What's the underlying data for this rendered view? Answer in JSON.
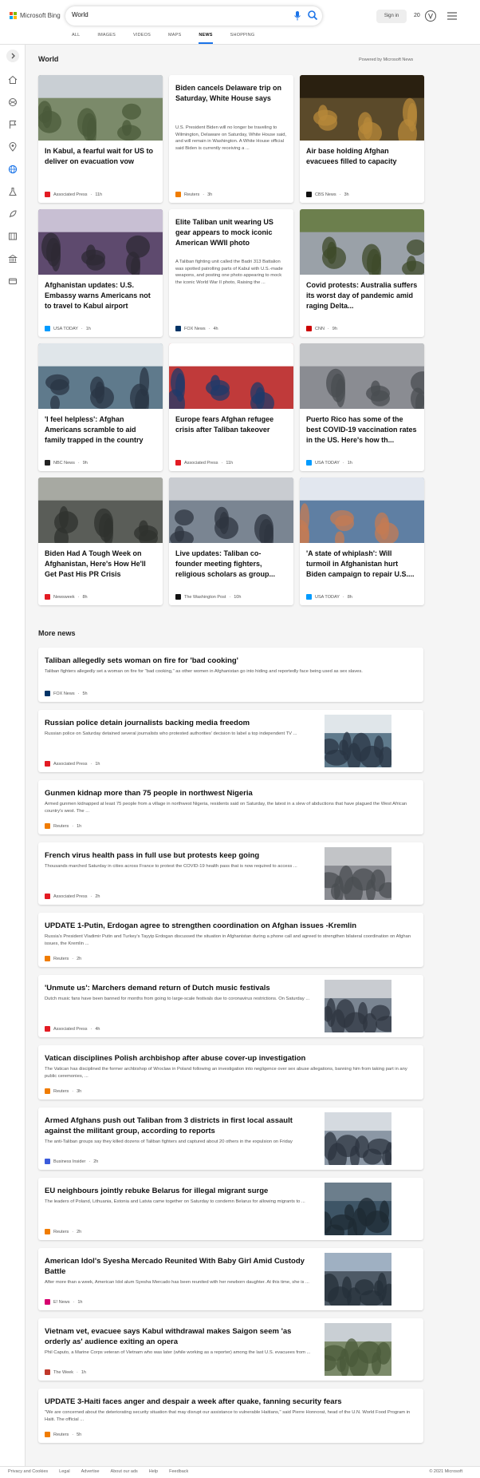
{
  "header": {
    "logo_text": "Microsoft Bing",
    "search_value": "World",
    "signin_label": "Sign in",
    "rewards_count": "20",
    "logo_colors": [
      "#f25022",
      "#7fba00",
      "#00a4ef",
      "#ffb900"
    ]
  },
  "tabs": [
    {
      "label": "ALL"
    },
    {
      "label": "IMAGES"
    },
    {
      "label": "VIDEOS"
    },
    {
      "label": "MAPS"
    },
    {
      "label": "NEWS",
      "active": true
    },
    {
      "label": "SHOPPING"
    }
  ],
  "accent_color": "#1a73e8",
  "rail_icons": [
    "home-icon",
    "sports-icon",
    "flag-icon",
    "location-icon",
    "globe-icon",
    "science-icon",
    "rocket-icon",
    "movie-icon",
    "bank-icon",
    "wallet-icon"
  ],
  "section": {
    "title": "World",
    "powered_by": "Powered by Microsoft News",
    "more_title": "More news"
  },
  "top_stories": [
    {
      "title": "In Kabul, a fearful wait for US to deliver on evacuation vow",
      "snippet": "",
      "source": "Associated Press",
      "age": "11h",
      "has_image": true,
      "logo_color": "#e31b23"
    },
    {
      "title": "Biden cancels Delaware trip on Saturday, White House says",
      "snippet": "U.S. President Biden will no longer be traveling to Wilmington, Delaware on Saturday, White House said, and will remain in Washington. A White House official said Biden is currently receiving a ...",
      "source": "Reuters",
      "age": "3h",
      "has_image": false,
      "logo_color": "#f07c00"
    },
    {
      "title": "Air base holding Afghan evacuees filled to capacity",
      "snippet": "",
      "source": "CBS News",
      "age": "3h",
      "has_image": true,
      "logo_color": "#111111"
    },
    {
      "title": "Afghanistan updates: U.S. Embassy warns Americans not to travel to Kabul airport",
      "snippet": "",
      "source": "USA TODAY",
      "age": "1h",
      "has_image": true,
      "logo_color": "#009bff"
    },
    {
      "title": "Elite Taliban unit wearing US gear appears to mock iconic American WWII photo",
      "snippet": "A Taliban fighting unit called the Badri 313 Battalion was spotted patrolling parts of Kabul with U.S.-made weapons, and posting one photo appearing to mock the iconic World War II photo, Raising the ...",
      "source": "FOX News",
      "age": "4h",
      "has_image": false,
      "logo_color": "#003366"
    },
    {
      "title": "Covid protests: Australia suffers its worst day of pandemic amid raging Delta...",
      "snippet": "",
      "source": "CNN",
      "age": "9h",
      "has_image": true,
      "logo_color": "#cc0000"
    },
    {
      "title": "'I feel helpless': Afghan Americans scramble to aid family trapped in the country",
      "snippet": "",
      "source": "NBC News",
      "age": "9h",
      "has_image": true,
      "logo_color": "#222222"
    },
    {
      "title": "Europe fears Afghan refugee crisis after Taliban takeover",
      "snippet": "",
      "source": "Associated Press",
      "age": "11h",
      "has_image": true,
      "logo_color": "#e31b23"
    },
    {
      "title": "Puerto Rico has some of the best COVID-19 vaccination rates in the US. Here's how th...",
      "snippet": "",
      "source": "USA TODAY",
      "age": "1h",
      "has_image": true,
      "logo_color": "#009bff"
    },
    {
      "title": "Biden Had A Tough Week on Afghanistan, Here's How He'll Get Past His PR Crisis",
      "snippet": "",
      "source": "Newsweek",
      "age": "8h",
      "has_image": true,
      "logo_color": "#e31b23"
    },
    {
      "title": "Live updates: Taliban co-founder meeting fighters, religious scholars as group...",
      "snippet": "",
      "source": "The Washington Post",
      "age": "10h",
      "has_image": true,
      "logo_color": "#111111"
    },
    {
      "title": "'A state of whiplash': Will turmoil in Afghanistan hurt Biden campaign to repair U.S....",
      "snippet": "",
      "source": "USA TODAY",
      "age": "8h",
      "has_image": true,
      "logo_color": "#009bff"
    }
  ],
  "more_news": [
    {
      "title": "Taliban allegedly sets woman on fire for 'bad cooking'",
      "snippet": "Taliban fighters allegedly set a woman on fire for \"bad cooking,\" as other women in Afghanistan go into hiding and reportedly face being used as sex slaves.",
      "source": "FOX News",
      "age": "5h",
      "has_image": false,
      "logo_color": "#003366"
    },
    {
      "title": "Russian police detain journalists backing media freedom",
      "snippet": "Russian police on Saturday detained several journalists who protested authorities' decision to label a top independent TV ...",
      "source": "Associated Press",
      "age": "1h",
      "has_image": true,
      "logo_color": "#e31b23"
    },
    {
      "title": "Gunmen kidnap more than 75 people in northwest Nigeria",
      "snippet": "Armed gunmen kidnapped at least 75 people from a village in northwest Nigeria, residents said on Saturday, the latest in a slew of abductions that have plagued the West African country's west. The ...",
      "source": "Reuters",
      "age": "1h",
      "has_image": false,
      "logo_color": "#f07c00"
    },
    {
      "title": "French virus health pass in full use but protests keep going",
      "snippet": "Thousands marched Saturday in cities across France to protest the COVID-19 health pass that is now required to access ...",
      "source": "Associated Press",
      "age": "2h",
      "has_image": true,
      "logo_color": "#e31b23"
    },
    {
      "title": "UPDATE 1-Putin, Erdogan agree to strengthen coordination on Afghan issues -Kremlin",
      "snippet": "Russia's President Vladimir Putin and Turkey's Tayyip Erdogan discussed the situation in Afghanistan during a phone call and agreed to strengthen bilateral coordination on Afghan issues, the Kremlin ...",
      "source": "Reuters",
      "age": "2h",
      "has_image": false,
      "logo_color": "#f07c00"
    },
    {
      "title": "'Unmute us': Marchers demand return of Dutch music festivals",
      "snippet": "Dutch music fans have been banned for months from going to large-scale festivals due to coronavirus restrictions. On Saturday ...",
      "source": "Associated Press",
      "age": "4h",
      "has_image": true,
      "logo_color": "#e31b23"
    },
    {
      "title": "Vatican disciplines Polish archbishop after abuse cover-up investigation",
      "snippet": "The Vatican has disciplined the former archbishop of Wroclaw in Poland following an investigation into negligence over sex abuse allegations, banning him from taking part in any public ceremonies, ...",
      "source": "Reuters",
      "age": "3h",
      "has_image": false,
      "logo_color": "#f07c00"
    },
    {
      "title": "Armed Afghans push out Taliban from 3 districts in first local assault against the militant group, according to reports",
      "snippet": "The anti-Taliban groups say they killed dozens of Taliban fighters and captured about 20 others in the expulsion on Friday",
      "source": "Business Insider",
      "age": "2h",
      "has_image": true,
      "logo_color": "#3b5bdb"
    },
    {
      "title": "EU neighbours jointly rebuke Belarus for illegal migrant surge",
      "snippet": "The leaders of Poland, Lithuania, Estonia and Latvia came together on Saturday to condemn Belarus for allowing migrants to ...",
      "source": "Reuters",
      "age": "2h",
      "has_image": true,
      "logo_color": "#f07c00"
    },
    {
      "title": "American Idol's Syesha Mercado Reunited With Baby Girl Amid Custody Battle",
      "snippet": "After more than a week, American Idol alum Syesha Mercado has been reunited with her newborn daughter. At this time, she is ...",
      "source": "E! News",
      "age": "1h",
      "has_image": true,
      "logo_color": "#d6006f"
    },
    {
      "title": "Vietnam vet, evacuee says Kabul withdrawal makes Saigon seem 'as orderly as' audience exiting an opera",
      "snippet": "Phil Caputo, a Marine Corps veteran of Vietnam who was later (while working as a reporter) among the last U.S. evacuees from ...",
      "source": "The Week",
      "age": "1h",
      "has_image": true,
      "logo_color": "#c0392b"
    },
    {
      "title": "UPDATE 3-Haiti faces anger and despair a week after quake, fanning security fears",
      "snippet": "\"We are concerned about the deteriorating security situation that may disrupt our assistance to vulnerable Haitians,\" said Pierre Honnorat, head of the U.N. World Food Program in Haiti. The official ...",
      "source": "Reuters",
      "age": "5h",
      "has_image": false,
      "logo_color": "#f07c00"
    }
  ],
  "footer": {
    "links": [
      "Privacy and Cookies",
      "Legal",
      "Advertise",
      "About our ads",
      "Help",
      "Feedback"
    ],
    "copyright": "© 2021 Microsoft"
  }
}
